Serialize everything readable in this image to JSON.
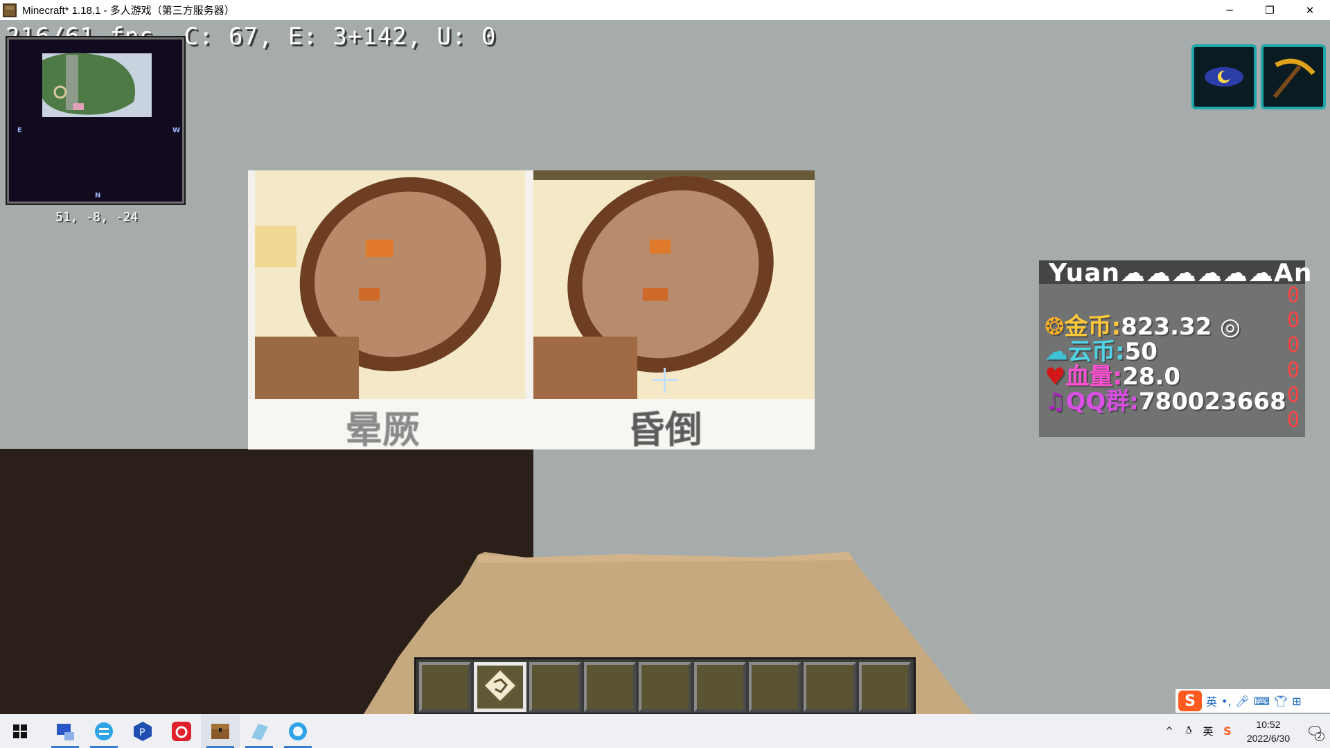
{
  "window": {
    "title": "Minecraft* 1.18.1 - 多人游戏（第三方服务器）",
    "minimize_glyph": "─",
    "restore_glyph": "❐",
    "close_glyph": "✕"
  },
  "hud": {
    "debug_line": "216/61 fps, C: 67, E: 3+142, U: 0",
    "coords": "51, -8, -24",
    "minimap_compass": {
      "east": "E",
      "west": "W",
      "north": "N"
    }
  },
  "painting": {
    "caption_left": "晕厥",
    "caption_right": "昏倒"
  },
  "effects": [
    {
      "icon": "night-vision-eye-icon"
    },
    {
      "icon": "haste-pickaxe-icon"
    }
  ],
  "scoreboard": {
    "title": "Yuan☁☁☁☁☁☁An",
    "lines": [
      {
        "icon": "coin-icon",
        "label": "金币:",
        "value": "823.32 ◎",
        "color": "#ffc837",
        "value_color": "#ffffff"
      },
      {
        "icon": "cloud-icon",
        "label": "云币:",
        "value": "50",
        "color": "#4fd4e6",
        "value_color": "#ffffff"
      },
      {
        "icon": "heart-icon",
        "label": "血量:",
        "value": "28.0",
        "color": "#ff4fd2",
        "value_color": "#ffffff"
      },
      {
        "icon": "music-note-icon",
        "label": "QQ群:",
        "value": "780023668",
        "color": "#d94fe3",
        "value_color": "#ffffff"
      }
    ],
    "scores": [
      "0",
      "0",
      "0",
      "0",
      "0",
      "0"
    ]
  },
  "hotbar": {
    "selected_index": 1,
    "slots": [
      {
        "item": ""
      },
      {
        "item": "map-icon"
      },
      {
        "item": ""
      },
      {
        "item": ""
      },
      {
        "item": ""
      },
      {
        "item": ""
      },
      {
        "item": ""
      },
      {
        "item": ""
      },
      {
        "item": ""
      }
    ]
  },
  "taskbar": {
    "apps": [
      {
        "name": "start"
      },
      {
        "name": "network-tool"
      },
      {
        "name": "file-transfer"
      },
      {
        "name": "p-app"
      },
      {
        "name": "netease-music"
      },
      {
        "name": "minecraft",
        "active": true
      },
      {
        "name": "eraser-app"
      },
      {
        "name": "browser"
      }
    ],
    "tray": {
      "input_lang": "英",
      "time": "10:52",
      "date": "2022/6/30",
      "notifications": "2"
    }
  },
  "ime": {
    "lang": "英",
    "punct": "•,",
    "tools": [
      "mic-icon",
      "keyboard-icon",
      "shirt-icon",
      "grid-icon"
    ]
  }
}
